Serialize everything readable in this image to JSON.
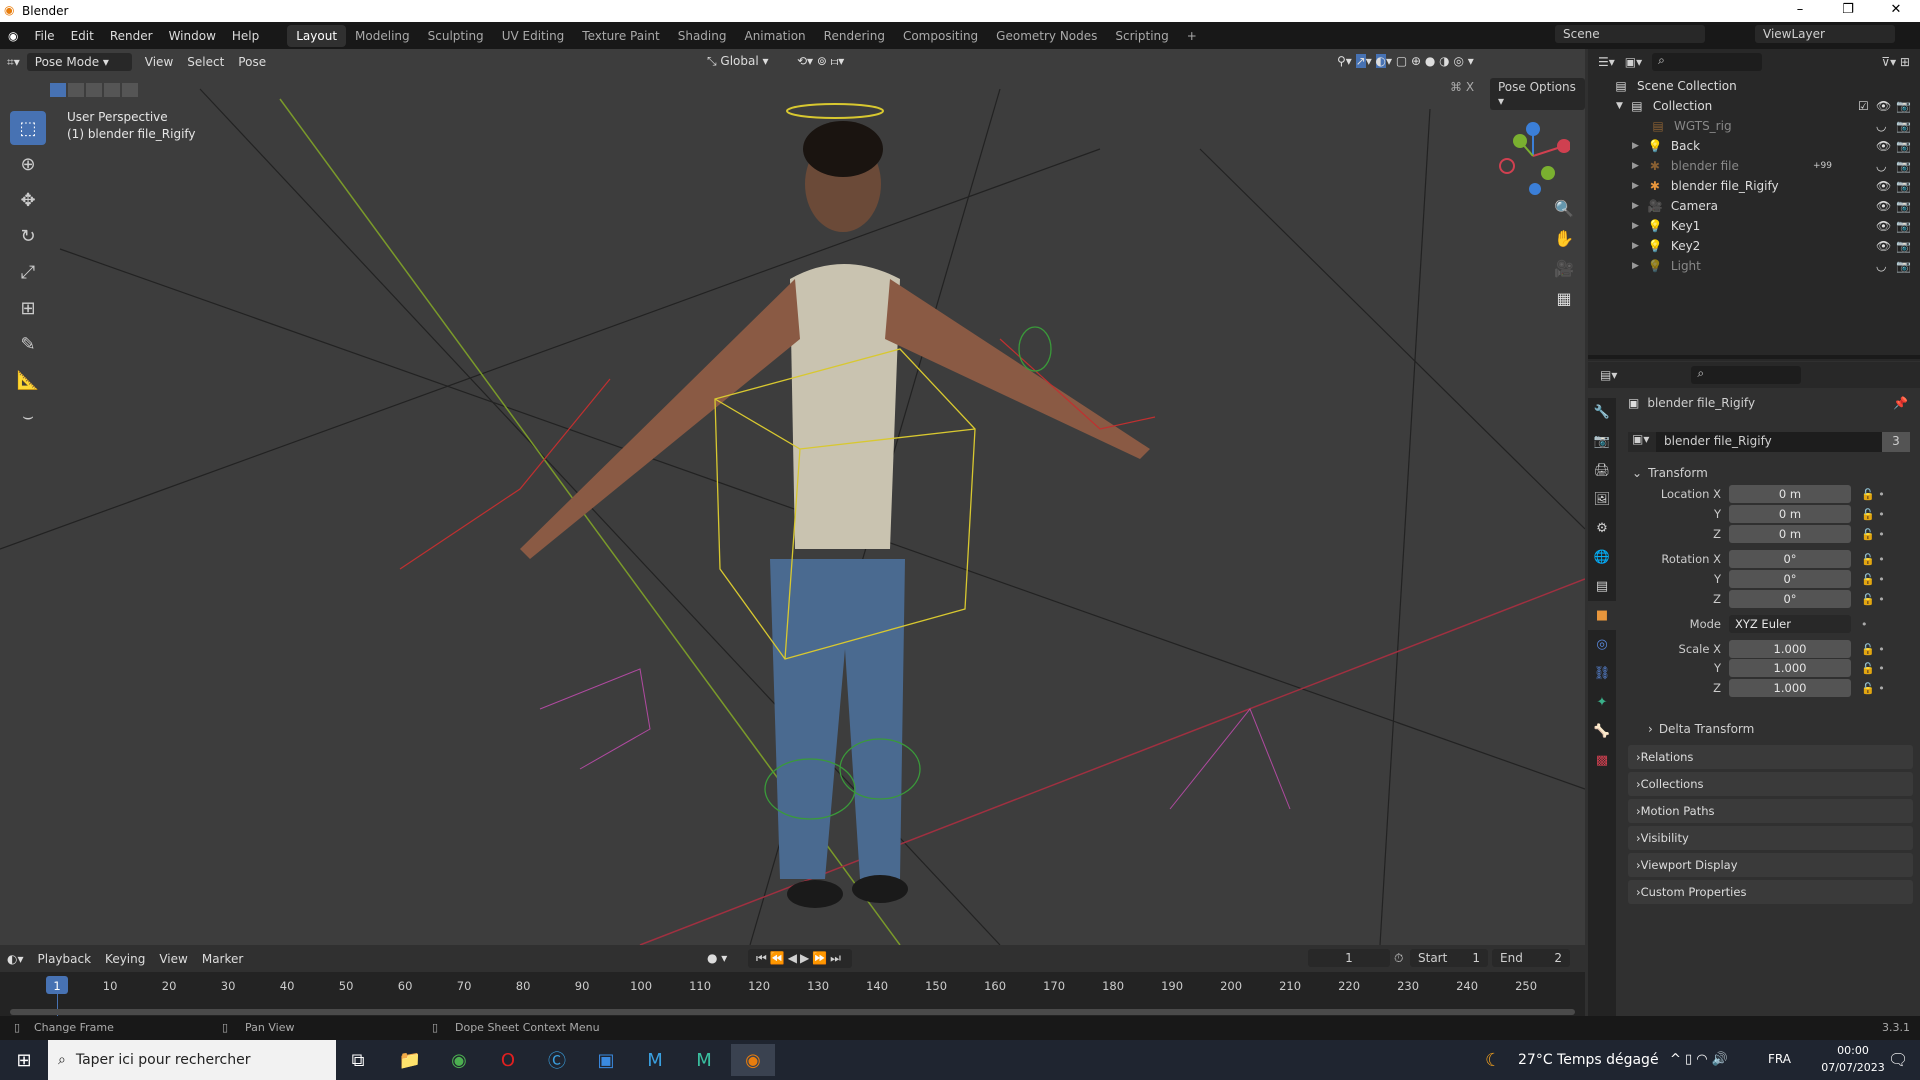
{
  "window": {
    "title": "Blender"
  },
  "menus": [
    "File",
    "Edit",
    "Render",
    "Window",
    "Help"
  ],
  "workspaces": [
    {
      "label": "Layout",
      "active": true
    },
    {
      "label": "Modeling"
    },
    {
      "label": "Sculpting"
    },
    {
      "label": "UV Editing"
    },
    {
      "label": "Texture Paint"
    },
    {
      "label": "Shading"
    },
    {
      "label": "Animation"
    },
    {
      "label": "Rendering"
    },
    {
      "label": "Compositing"
    },
    {
      "label": "Geometry Nodes"
    },
    {
      "label": "Scripting"
    },
    {
      "label": "+"
    }
  ],
  "scene": {
    "name": "Scene",
    "view_layer": "ViewLayer"
  },
  "viewport": {
    "mode": "Pose Mode",
    "menus": [
      "View",
      "Select",
      "Pose"
    ],
    "orientation": "Global",
    "pose_options": "Pose Options",
    "x_mirror": "X",
    "perspective": "User Perspective",
    "object_info": "(1) blender file_Rigify"
  },
  "outliner": {
    "root": "Scene Collection",
    "collection": "Collection",
    "items": [
      {
        "label": "WGTS_rig",
        "dim": true,
        "icon": "collection"
      },
      {
        "label": "Back",
        "icon": "light"
      },
      {
        "label": "blender file",
        "dim": true,
        "icon": "armature",
        "badge": "+99"
      },
      {
        "label": "blender file_Rigify",
        "icon": "armature"
      },
      {
        "label": "Camera",
        "icon": "camera"
      },
      {
        "label": "Key1",
        "icon": "light"
      },
      {
        "label": "Key2",
        "icon": "light"
      },
      {
        "label": "Light",
        "dim": true,
        "icon": "light"
      }
    ]
  },
  "properties": {
    "object_name": "blender file_Rigify",
    "datablock": "blender file_Rigify",
    "users": "3",
    "transform_label": "Transform",
    "fields": [
      {
        "label": "Location X",
        "value": "0 m"
      },
      {
        "label": "Y",
        "value": "0 m"
      },
      {
        "label": "Z",
        "value": "0 m"
      },
      {
        "label": "Rotation X",
        "value": "0°"
      },
      {
        "label": "Y",
        "value": "0°"
      },
      {
        "label": "Z",
        "value": "0°"
      },
      {
        "label": "Mode",
        "value": "XYZ Euler"
      },
      {
        "label": "Scale X",
        "value": "1.000"
      },
      {
        "label": "Y",
        "value": "1.000"
      },
      {
        "label": "Z",
        "value": "1.000"
      }
    ],
    "delta": "Delta Transform",
    "panels": [
      "Relations",
      "Collections",
      "Motion Paths",
      "Visibility",
      "Viewport Display",
      "Custom Properties"
    ]
  },
  "timeline": {
    "menus": [
      "Playback",
      "Keying",
      "View",
      "Marker"
    ],
    "current_frame": "1",
    "start_label": "Start",
    "start": "1",
    "end_label": "End",
    "end": "2",
    "ticks": [
      1,
      10,
      20,
      30,
      40,
      50,
      60,
      70,
      80,
      90,
      100,
      110,
      120,
      130,
      140,
      150,
      160,
      170,
      180,
      190,
      200,
      210,
      220,
      230,
      240,
      250
    ]
  },
  "status": {
    "change_frame": "Change Frame",
    "pan_view": "Pan View",
    "context_menu": "Dope Sheet Context Menu",
    "version": "3.3.1"
  },
  "taskbar": {
    "search_placeholder": "Taper ici pour rechercher",
    "weather": "27°C  Temps dégagé",
    "lang": "FRA",
    "time": "00:00",
    "date": "07/07/2023"
  }
}
